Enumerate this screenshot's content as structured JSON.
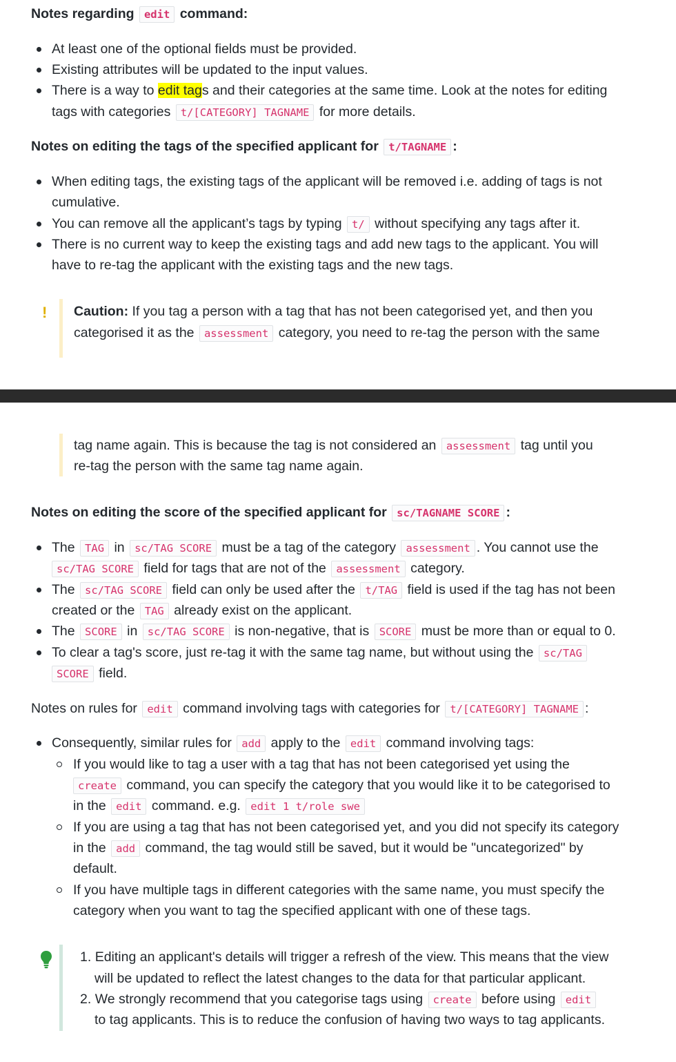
{
  "edit_section": {
    "heading": {
      "t1": "Notes regarding",
      "c1": "edit",
      "t2": "command:"
    },
    "bullets": [
      {
        "t1": "At least one of the optional fields must be provided."
      },
      {
        "t1": "Existing attributes will be updated to the input values."
      },
      {
        "t1": "There is a way to",
        "hl": "edit tag",
        "t2": "s and their categories at the same time. Look at the notes for editing"
      },
      {
        "t1": "tags with categories",
        "c1": "t/[CATEGORY] TAGNAME",
        "t2": "for more details."
      }
    ]
  },
  "tags_section": {
    "heading": {
      "t1": "Notes on editing the tags of the specified applicant for",
      "c1": "t/TAGNAME",
      "t2": ":"
    },
    "lines": [
      {
        "t1": "When editing tags, the existing tags of the applicant will be removed i.e. adding of tags is not"
      },
      {
        "t1": "cumulative."
      },
      {
        "t1": "You can remove all the applicant’s tags by typing",
        "c1": "t/",
        "t2": "without specifying any tags after it."
      },
      {
        "t1": "There is no current way to keep the existing tags and add new tags to the applicant. You will"
      },
      {
        "t1": "have to re-tag the applicant with the existing tags and the new tags."
      }
    ]
  },
  "caution": {
    "icon": "exclamation-icon",
    "label": "Caution:",
    "l1": "If you tag a person with a tag that has not been categorised yet, and then you",
    "l2a": "categorised it as the",
    "l2c": "assessment",
    "l2b": "category, you need to re-tag the person with the same",
    "l3a": "tag name again. This is because the tag is not considered an",
    "l3c": "assessment",
    "l3b": "tag until you",
    "l4": "re-tag the person with the same tag name again."
  },
  "score_section": {
    "heading": {
      "t1": "Notes on editing the score of the specified applicant for",
      "c1": "sc/TAGNAME SCORE",
      "t2": ":"
    },
    "l1": {
      "t1": "The",
      "c1": "TAG",
      "t2": "in",
      "c2": "sc/TAG SCORE",
      "t3": "must be a tag of the category",
      "c3": "assessment",
      "t4": ". You cannot use the"
    },
    "l2": {
      "c1": "sc/TAG SCORE",
      "t1": "field for tags that are not of the",
      "c2": "assessment",
      "t2": "category."
    },
    "l3": {
      "t1": "The",
      "c1": "sc/TAG SCORE",
      "t2": "field can only be used after the",
      "c2": "t/TAG",
      "t3": "field is used if the tag has not been"
    },
    "l4": {
      "t1": "created or the",
      "c1": "TAG",
      "t2": "already exist on the applicant."
    },
    "l5": {
      "t1": "The",
      "c1": "SCORE",
      "t2": "in",
      "c2": "sc/TAG SCORE",
      "t3": "is non-negative, that is",
      "c3": "SCORE",
      "t4": "must be more than or equal to 0."
    },
    "l6": {
      "t1": "To clear a tag's score, just re-tag it with the same tag name, but without using the",
      "c1": "sc/TAG"
    },
    "l7": {
      "c1": "SCORE",
      "t1": "field."
    }
  },
  "rules_section": {
    "heading": {
      "t1": "Notes on rules for",
      "c1": "edit",
      "t2": "command involving tags with categories for",
      "c2": "t/[CATEGORY] TAGNAME",
      "t3": ":"
    },
    "l1": {
      "t1": "Consequently, similar rules for",
      "c1": "add",
      "t2": "apply to the",
      "c2": "edit",
      "t3": "command involving tags:"
    },
    "l2": {
      "t1": "If you would like to tag a user with a tag that has not been categorised yet using the"
    },
    "l3": {
      "c1": "create",
      "t1": "command, you can specify the category that you would like it to be categorised to"
    },
    "l4": {
      "t1": "in the",
      "c1": "edit",
      "t2": "command. e.g.",
      "c2": "edit 1 t/role swe"
    },
    "l5": {
      "t1": "If you are using a tag that has not been categorised yet, and you did not specify its category"
    },
    "l6": {
      "t1": "in the",
      "c1": "add",
      "t2": "command, the tag would still be saved, but it would be \"uncategorized\" by"
    },
    "l7": {
      "t1": "default."
    },
    "l8": {
      "t1": "If you have multiple tags in different categories with the same name, you must specify the"
    },
    "l9": {
      "t1": "category when you want to tag the specified applicant with one of these tags."
    }
  },
  "tip": {
    "icon": "lightbulb-icon",
    "n1": "1.",
    "l1": "Editing an applicant's details will trigger a refresh of the view. This means that the view",
    "l2": "will be updated to reflect the latest changes to the data for that particular applicant.",
    "n2": "2.",
    "l3a": "We strongly recommend that you categorise tags using",
    "l3c1": "create",
    "l3b": "before using",
    "l3c2": "edit",
    "l4": "to tag applicants. This is to reduce the confusion of having two ways to tag applicants."
  },
  "colors": {
    "code_text": "#d6336c",
    "caution_bar": "#fcefc7",
    "tip_bar": "#d1e7dd",
    "tip_icon": "#2e9e3e",
    "highlight": "#ffff00",
    "divider": "#2b2b2b"
  }
}
